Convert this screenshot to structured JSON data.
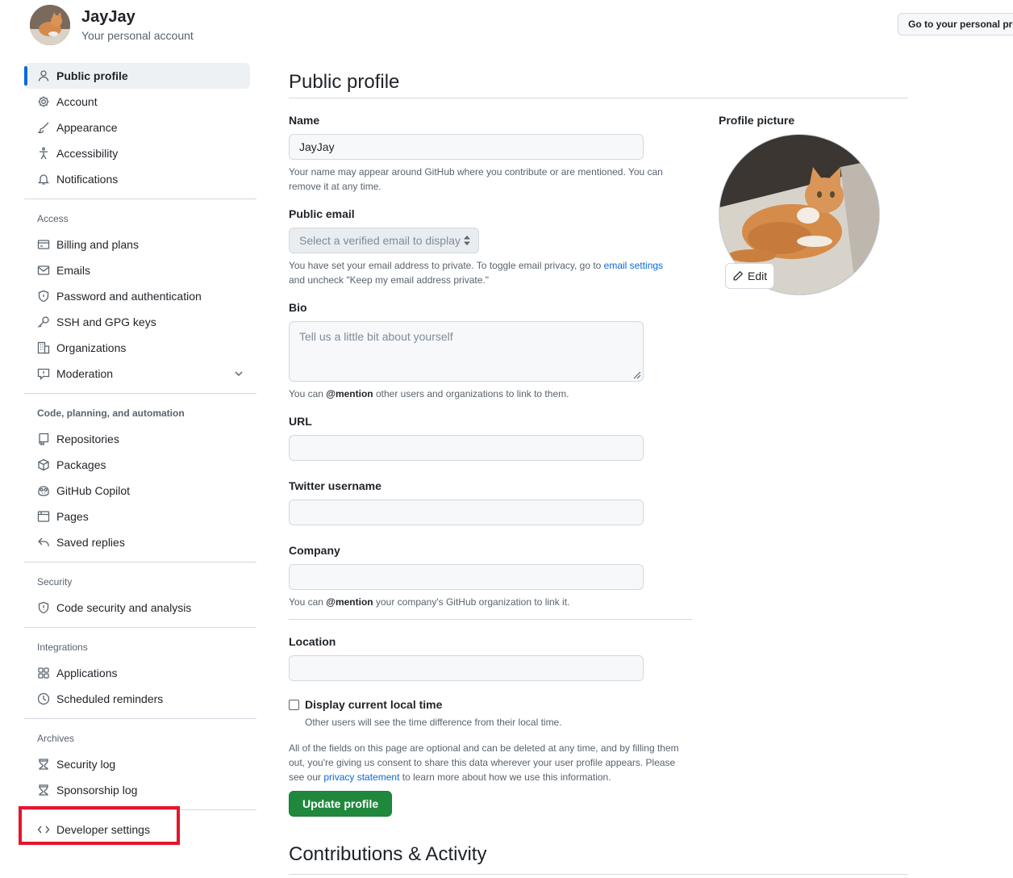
{
  "header": {
    "name": "JayJay",
    "subtitle": "Your personal account",
    "goto_button": "Go to your personal profile"
  },
  "sidebar": {
    "top_items": [
      {
        "label": "Public profile",
        "icon": "person-icon"
      },
      {
        "label": "Account",
        "icon": "gear-icon"
      },
      {
        "label": "Appearance",
        "icon": "paintbrush-icon"
      },
      {
        "label": "Accessibility",
        "icon": "accessibility-icon"
      },
      {
        "label": "Notifications",
        "icon": "bell-icon"
      }
    ],
    "access_title": "Access",
    "access_items": [
      {
        "label": "Billing and plans",
        "icon": "credit-card-icon"
      },
      {
        "label": "Emails",
        "icon": "mail-icon"
      },
      {
        "label": "Password and authentication",
        "icon": "shield-lock-icon"
      },
      {
        "label": "SSH and GPG keys",
        "icon": "key-icon"
      },
      {
        "label": "Organizations",
        "icon": "organization-icon"
      },
      {
        "label": "Moderation",
        "icon": "report-icon"
      }
    ],
    "code_title": "Code, planning, and automation",
    "code_items": [
      {
        "label": "Repositories",
        "icon": "repo-icon"
      },
      {
        "label": "Packages",
        "icon": "package-icon"
      },
      {
        "label": "GitHub Copilot",
        "icon": "copilot-icon"
      },
      {
        "label": "Pages",
        "icon": "browser-icon"
      },
      {
        "label": "Saved replies",
        "icon": "reply-icon"
      }
    ],
    "security_title": "Security",
    "security_items": [
      {
        "label": "Code security and analysis",
        "icon": "codescan-icon"
      }
    ],
    "integrations_title": "Integrations",
    "integrations_items": [
      {
        "label": "Applications",
        "icon": "apps-icon"
      },
      {
        "label": "Scheduled reminders",
        "icon": "clock-icon"
      }
    ],
    "archives_title": "Archives",
    "archives_items": [
      {
        "label": "Security log",
        "icon": "log-icon"
      },
      {
        "label": "Sponsorship log",
        "icon": "log-icon"
      }
    ],
    "developer": {
      "label": "Developer settings",
      "icon": "code-icon"
    }
  },
  "main": {
    "title": "Public profile",
    "name_label": "Name",
    "name_value": "JayJay",
    "name_note": "Your name may appear around GitHub where you contribute or are mentioned. You can remove it at any time.",
    "email_label": "Public email",
    "email_select": "Select a verified email to display",
    "email_note_pre": "You have set your email address to private. To toggle email privacy, go to ",
    "email_note_link": "email settings",
    "email_note_post": " and uncheck \"Keep my email address private.\"",
    "bio_label": "Bio",
    "bio_placeholder": "Tell us a little bit about yourself",
    "bio_note_pre": "You can ",
    "bio_note_bold": "@mention",
    "bio_note_post": " other users and organizations to link to them.",
    "url_label": "URL",
    "twitter_label": "Twitter username",
    "company_label": "Company",
    "company_note_pre": "You can ",
    "company_note_bold": "@mention",
    "company_note_post": " your company's GitHub organization to link it.",
    "location_label": "Location",
    "local_time_label": "Display current local time",
    "local_time_note": "Other users will see the time difference from their local time.",
    "consent_pre": "All of the fields on this page are optional and can be deleted at any time, and by filling them out, you're giving us consent to share this data wherever your user profile appears. Please see our ",
    "consent_link": "privacy statement",
    "consent_post": " to learn more about how we use this information.",
    "update_button": "Update profile",
    "section2_title": "Contributions & Activity"
  },
  "profile_picture": {
    "label": "Profile picture",
    "edit_label": "Edit"
  },
  "colors": {
    "accent": "#0969da",
    "primary_button": "#1f883d",
    "highlight": "#e5152b"
  }
}
